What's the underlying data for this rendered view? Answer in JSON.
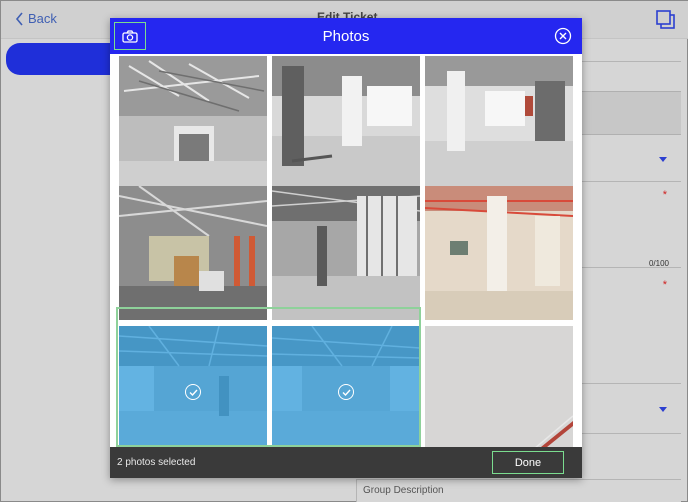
{
  "background": {
    "back_label": "Back",
    "title": "Edit Ticket",
    "counter": "0/100",
    "group_description_label": "Group Description",
    "required_marker": "*"
  },
  "modal": {
    "title": "Photos",
    "selected_count_text": "2 photos selected",
    "done_label": "Done",
    "accent_color": "#2527f0",
    "highlight_color": "#7bdc8f"
  },
  "photos": [
    {
      "name": "ceiling-ducts",
      "selected": false
    },
    {
      "name": "empty-floor-columns",
      "selected": false
    },
    {
      "name": "empty-floor-windows",
      "selected": false
    },
    {
      "name": "construction-scaffold",
      "selected": false
    },
    {
      "name": "glass-wall-corridor",
      "selected": false
    },
    {
      "name": "room-with-column",
      "selected": false
    },
    {
      "name": "open-floor-1",
      "selected": true
    },
    {
      "name": "open-floor-2",
      "selected": true
    },
    {
      "name": "blank-wall",
      "selected": false
    }
  ]
}
